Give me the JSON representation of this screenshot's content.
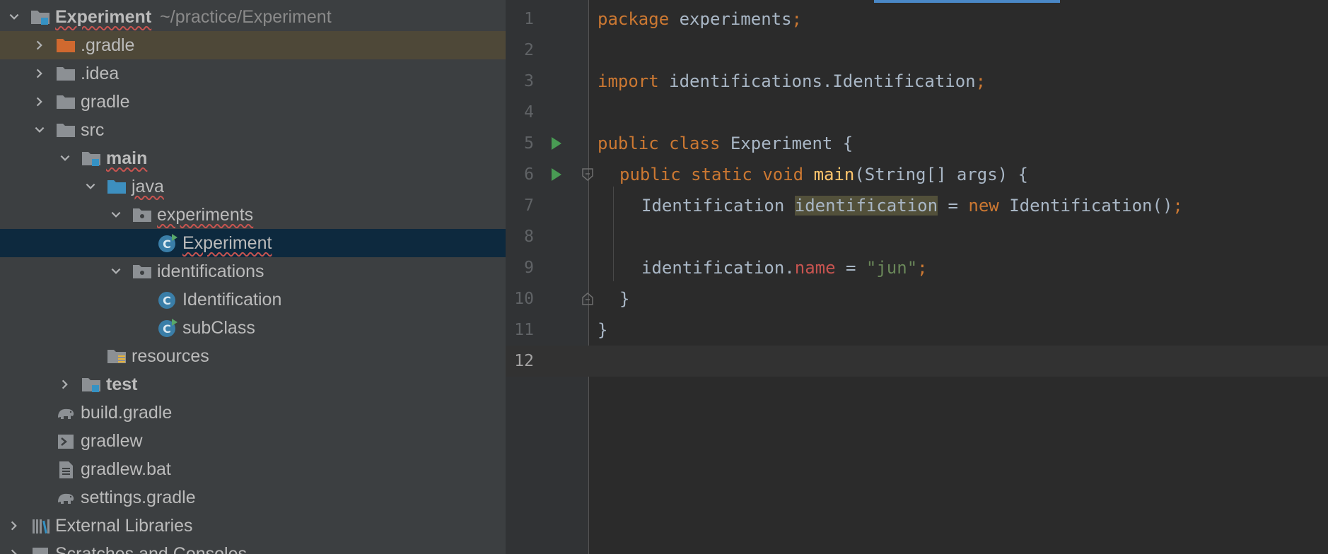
{
  "project_tree": {
    "root": {
      "name": "Experiment",
      "path": "~/practice/Experiment"
    },
    "items": [
      {
        "label": ".gradle"
      },
      {
        "label": ".idea"
      },
      {
        "label": "gradle"
      },
      {
        "label": "src"
      },
      {
        "label": "main"
      },
      {
        "label": "java"
      },
      {
        "label": "experiments"
      },
      {
        "label": "Experiment"
      },
      {
        "label": "identifications"
      },
      {
        "label": "Identification"
      },
      {
        "label": "subClass"
      },
      {
        "label": "resources"
      },
      {
        "label": "test"
      },
      {
        "label": "build.gradle"
      },
      {
        "label": "gradlew"
      },
      {
        "label": "gradlew.bat"
      },
      {
        "label": "settings.gradle"
      },
      {
        "label": "External Libraries"
      },
      {
        "label": "Scratches and Consoles"
      }
    ]
  },
  "editor": {
    "line_numbers": [
      "1",
      "2",
      "3",
      "4",
      "5",
      "6",
      "7",
      "8",
      "9",
      "10",
      "11",
      "12"
    ],
    "current_line": "12",
    "lines": {
      "l1": {
        "kw": "package",
        "rest": " experiments",
        "semi": ";"
      },
      "l3": {
        "kw": "import",
        "rest": " identifications.Identification",
        "semi": ";"
      },
      "l5": {
        "kw1": "public",
        "kw2": "class",
        "rest": " Experiment {"
      },
      "l6": {
        "kw1": "public",
        "kw2": "static",
        "kw3": "void",
        "fn": "main",
        "rest": "(String[] args) {"
      },
      "l7": {
        "type": "Identification ",
        "var": "identification",
        "eq": " = ",
        "kw": "new",
        "rest": " Identification()",
        "semi": ";"
      },
      "l9": {
        "obj": "identification.",
        "field": "name",
        "eq": " = ",
        "str": "\"jun\"",
        "semi": ";"
      },
      "l10": {
        "text": "}"
      },
      "l11": {
        "text": "}"
      }
    }
  },
  "colors": {
    "keyword": "#cc7832",
    "string": "#6a8759",
    "method": "#ffc66d",
    "field": "#c75450",
    "selection": "#0d293e",
    "run_icon": "#499c54"
  }
}
